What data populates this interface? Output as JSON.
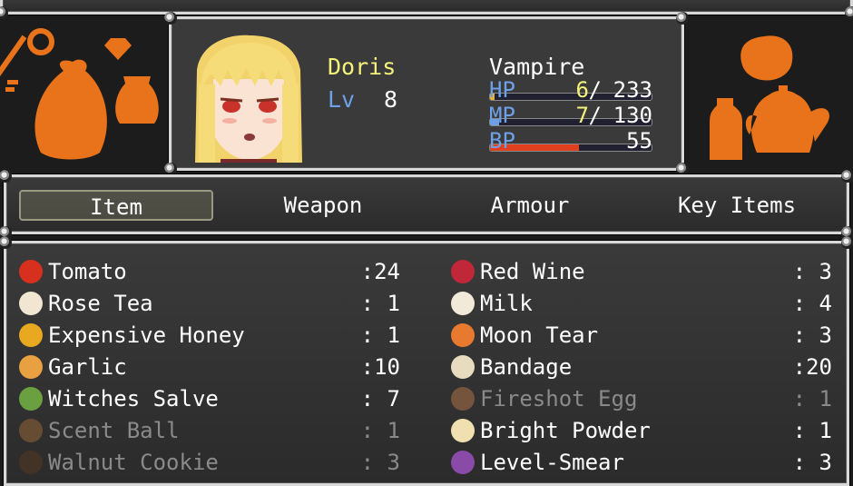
{
  "actor": {
    "name": "Doris",
    "level_label": "Lv",
    "level": "8",
    "class": "Vampire",
    "hp_label": "HP",
    "hp_cur": "6",
    "hp_max": "233",
    "hp_fraction": 0.026,
    "mp_label": "MP",
    "mp_cur": "7",
    "mp_max": "130",
    "mp_fraction": 0.054,
    "bp_label": "BP",
    "bp": "55",
    "bp_fraction": 0.55,
    "sep": "/"
  },
  "colors": {
    "accent": "#e8731a",
    "hp": "#e8b430",
    "bp": "#e04020",
    "system": "#6ea0e8",
    "name": "#f5f27a"
  },
  "categories": [
    "Item",
    "Weapon",
    "Armour",
    "Key Items"
  ],
  "selected_category": "Item",
  "items_left": [
    {
      "name": "Tomato",
      "count": ":24",
      "icon": "tomato-icon",
      "enabled": true
    },
    {
      "name": "Rose Tea",
      "count": ": 1",
      "icon": "tea-cup-icon",
      "enabled": true
    },
    {
      "name": "Expensive Honey",
      "count": ": 1",
      "icon": "honey-jar-icon",
      "enabled": true
    },
    {
      "name": "Garlic",
      "count": ":10",
      "icon": "garlic-icon",
      "enabled": true
    },
    {
      "name": "Witches Salve",
      "count": ": 7",
      "icon": "salve-jar-icon",
      "enabled": true
    },
    {
      "name": "Scent Ball",
      "count": ": 1",
      "icon": "scent-ball-icon",
      "enabled": false
    },
    {
      "name": "Walnut Cookie",
      "count": ": 3",
      "icon": "cookie-icon",
      "enabled": false
    }
  ],
  "items_right": [
    {
      "name": "Red Wine",
      "count": ": 3",
      "icon": "wine-bottle-icon",
      "enabled": true
    },
    {
      "name": "Milk",
      "count": ": 4",
      "icon": "milk-bottle-icon",
      "enabled": true
    },
    {
      "name": "Moon Tear",
      "count": ": 3",
      "icon": "potion-flask-icon",
      "enabled": true
    },
    {
      "name": "Bandage",
      "count": ":20",
      "icon": "bandage-icon",
      "enabled": true
    },
    {
      "name": "Fireshot Egg",
      "count": ": 1",
      "icon": "egg-icon",
      "enabled": false
    },
    {
      "name": "Bright Powder",
      "count": ": 1",
      "icon": "powder-plate-icon",
      "enabled": true
    },
    {
      "name": "Level-Smear",
      "count": ": 3",
      "icon": "purple-vial-icon",
      "enabled": true
    }
  ]
}
